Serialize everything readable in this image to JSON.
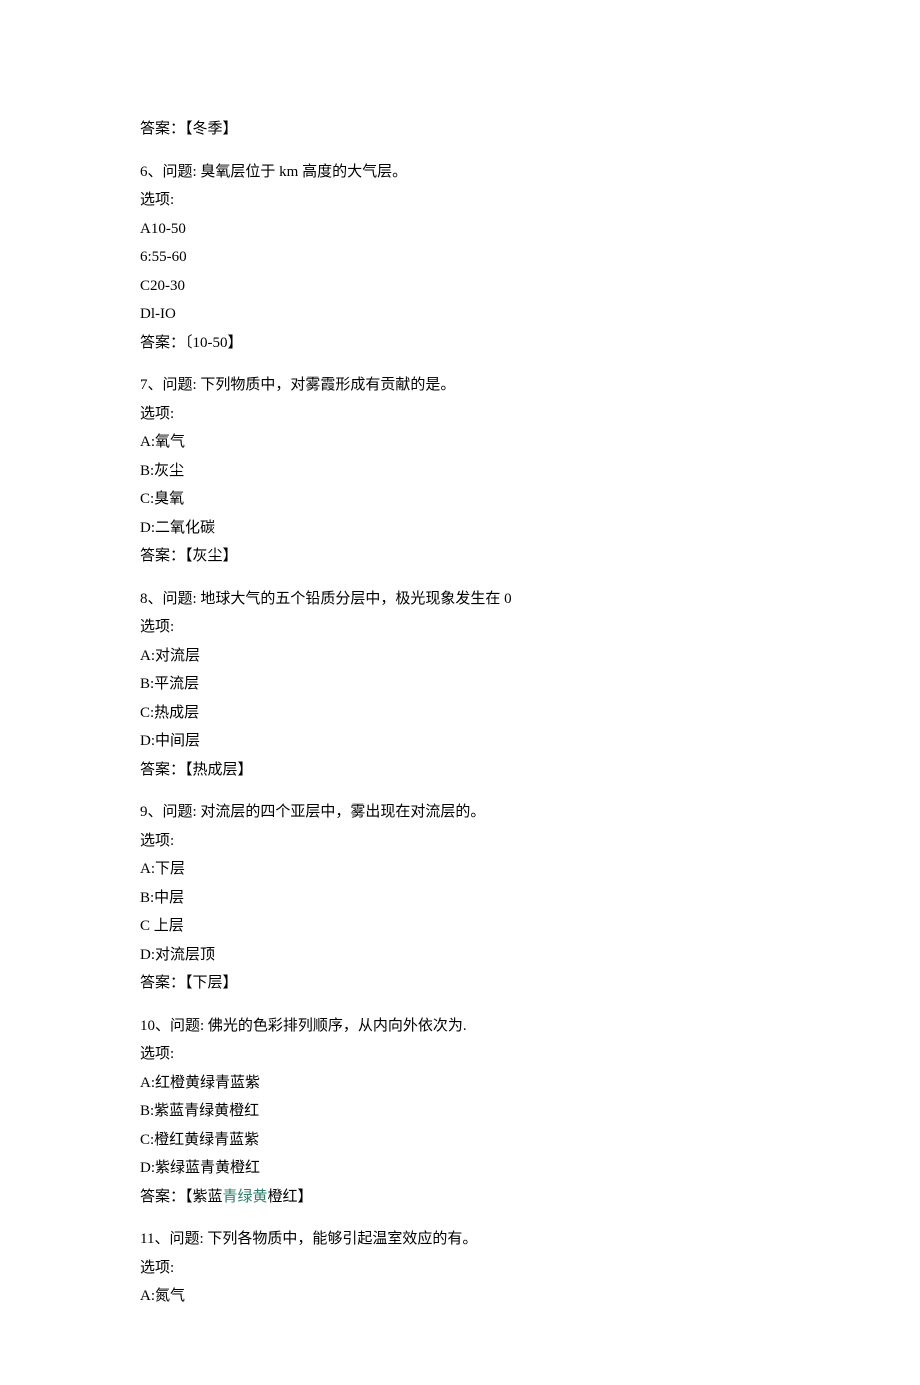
{
  "q5": {
    "answer_prefix": "答案：【",
    "answer_value": "冬季",
    "answer_suffix": "】"
  },
  "q6": {
    "question": "6、问题: 臭氧层位于 km 高度的大气层。",
    "xuanxiang": "选项:",
    "optA": "A10-50",
    "optB": "6:55-60",
    "optC": "C20-30",
    "optD": "Dl-IO",
    "answer_prefix": "答案：〔",
    "answer_value": "10-50",
    "answer_suffix": "】"
  },
  "q7": {
    "question": "7、问题: 下列物质中，对雾霞形成有贡献的是。",
    "xuanxiang": "选项:",
    "optA": "A:氧气",
    "optB": "B:灰尘",
    "optC": "C:臭氧",
    "optD": "D:二氧化碳",
    "answer_prefix": "答案：【",
    "answer_value": "灰尘",
    "answer_suffix": "】"
  },
  "q8": {
    "question": "8、问题: 地球大气的五个铅质分层中，极光现象发生在 0",
    "xuanxiang": "选项:",
    "optA": "A:对流层",
    "optB": "B:平流层",
    "optC": "C:热成层",
    "optD": "D:中间层",
    "answer_prefix": "答案：【",
    "answer_value": "热成层",
    "answer_suffix": "】"
  },
  "q9": {
    "question": "9、问题: 对流层的四个亚层中，雾出现在对流层的。",
    "xuanxiang": "选项:",
    "optA": "A:下层",
    "optB": "B:中层",
    "optC": "C 上层",
    "optD": "D:对流层顶",
    "answer_prefix": "答案：【",
    "answer_value": "下层",
    "answer_suffix": "】"
  },
  "q10": {
    "question": "10、问题: 佛光的色彩排列顺序，从内向外依次为.",
    "xuanxiang": "选项:",
    "optA": "A:红橙黄绿青蓝紫",
    "optB": "B:紫蓝青绿黄橙红",
    "optC": "C:橙红黄绿青蓝紫",
    "optD": "D:紫绿蓝青黄橙红",
    "answer_prefix": "答案：【紫蓝",
    "answer_colored": "青绿黄",
    "answer_suffix": "橙红】"
  },
  "q11": {
    "question": "11、问题: 下列各物质中，能够引起温室效应的有。",
    "xuanxiang": "选项:",
    "optA": "A:氮气"
  }
}
